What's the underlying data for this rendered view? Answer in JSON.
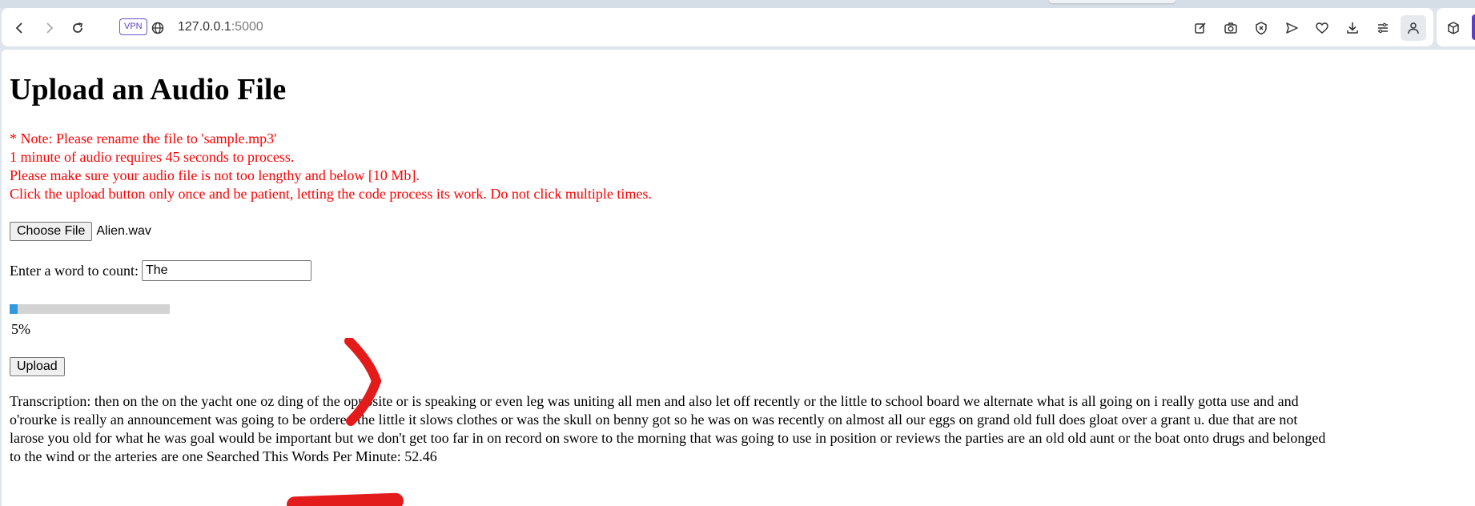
{
  "browser": {
    "vpn_badge": "VPN",
    "url_host": "127.0.0.1",
    "url_port": ":5000",
    "icons": [
      "back-arrow-icon",
      "forward-arrow-icon",
      "reload-icon",
      "globe-icon",
      "edit-page-icon",
      "camera-icon",
      "shield-x-icon",
      "send-icon",
      "heart-icon",
      "download-icon",
      "menu-lines-icon",
      "profile-icon",
      "cube-icon"
    ]
  },
  "page": {
    "title": "Upload an Audio File",
    "notes": [
      "* Note: Please rename the file to 'sample.mp3'",
      "1 minute of audio requires 45 seconds to process.",
      "Please make sure your audio file is not too lengthy and below [10 Mb].",
      "Click the upload button only once and be patient, letting the code process its work. Do not click multiple times."
    ],
    "choose_file_label": "Choose File",
    "file_name": "Alien.wav",
    "word_label": "Enter a word to count:",
    "word_value": "The",
    "progress_fraction": 0.05,
    "progress_text": "5%",
    "upload_label": "Upload",
    "transcription": "Transcription: then on the on the yacht one oz ding of the opposite or is speaking or even leg was uniting all men and also let off recently or the little to school board we alternate what is all going on i really gotta use and and\no'rourke is really an announcement was going to be ordered the little it slows clothes or was the skull on benny got so he was on was recently on almost all our eggs on grand old full does gloat over a grant u. due that are not\nlarose you old for what he was goal would be important but we don't get too far in on record on swore to the morning that was going to use in position or reviews the parties are an old old aunt or the boat onto drugs and belonged\nto the wind or the arteries are one Searched                          This Words Per Minute: 52.46",
    "accent_colors": {
      "notes": "#ff0000",
      "progress_fill": "#3399dd",
      "annotation": "#e31b1b"
    }
  }
}
